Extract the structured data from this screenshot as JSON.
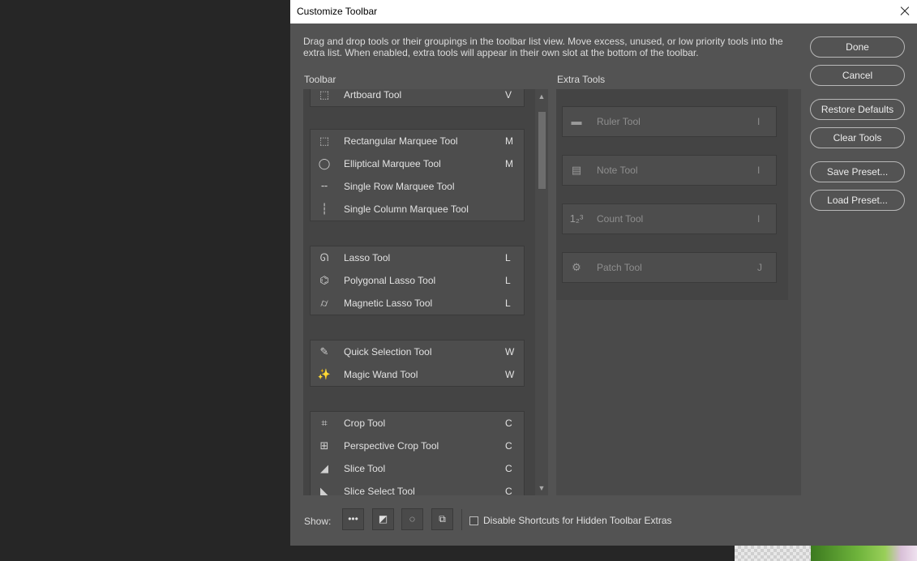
{
  "dialog": {
    "title": "Customize Toolbar",
    "description": "Drag and drop tools or their groupings in the toolbar list view. Move excess, unused, or low priority tools into the extra list. When enabled, extra tools will appear in their own slot at the bottom of the toolbar."
  },
  "toolbar": {
    "label": "Toolbar",
    "groups": [
      {
        "tools": [
          {
            "icon": "artboard-icon",
            "glyph": "⬚",
            "name": "Artboard Tool",
            "key": "V"
          }
        ]
      },
      {
        "tools": [
          {
            "icon": "rectangular-marquee-icon",
            "glyph": "⬚",
            "name": "Rectangular Marquee Tool",
            "key": "M"
          },
          {
            "icon": "elliptical-marquee-icon",
            "glyph": "◯",
            "name": "Elliptical Marquee Tool",
            "key": "M"
          },
          {
            "icon": "single-row-marquee-icon",
            "glyph": "╌",
            "name": "Single Row Marquee Tool",
            "key": ""
          },
          {
            "icon": "single-column-marquee-icon",
            "glyph": "┆",
            "name": "Single Column Marquee Tool",
            "key": ""
          }
        ]
      },
      {
        "tools": [
          {
            "icon": "lasso-icon",
            "glyph": "ᘏ",
            "name": "Lasso Tool",
            "key": "L"
          },
          {
            "icon": "polygonal-lasso-icon",
            "glyph": "⌬",
            "name": "Polygonal Lasso Tool",
            "key": "L"
          },
          {
            "icon": "magnetic-lasso-icon",
            "glyph": "⌭",
            "name": "Magnetic Lasso Tool",
            "key": "L"
          }
        ]
      },
      {
        "tools": [
          {
            "icon": "quick-selection-icon",
            "glyph": "✎",
            "name": "Quick Selection Tool",
            "key": "W"
          },
          {
            "icon": "magic-wand-icon",
            "glyph": "✨",
            "name": "Magic Wand Tool",
            "key": "W"
          }
        ]
      },
      {
        "tools": [
          {
            "icon": "crop-icon",
            "glyph": "⌗",
            "name": "Crop Tool",
            "key": "C"
          },
          {
            "icon": "perspective-crop-icon",
            "glyph": "⊞",
            "name": "Perspective Crop Tool",
            "key": "C"
          },
          {
            "icon": "slice-icon",
            "glyph": "◢",
            "name": "Slice Tool",
            "key": "C"
          },
          {
            "icon": "slice-select-icon",
            "glyph": "◣",
            "name": "Slice Select Tool",
            "key": "C"
          }
        ]
      }
    ]
  },
  "extra_tools": {
    "label": "Extra Tools",
    "items": [
      {
        "icon": "ruler-icon",
        "glyph": "▬",
        "name": "Ruler Tool",
        "key": "I"
      },
      {
        "icon": "note-icon",
        "glyph": "▤",
        "name": "Note Tool",
        "key": "I"
      },
      {
        "icon": "count-icon",
        "glyph": "1₂³",
        "name": "Count Tool",
        "key": "I"
      },
      {
        "icon": "patch-icon",
        "glyph": "⚙",
        "name": "Patch Tool",
        "key": "J"
      }
    ]
  },
  "buttons": {
    "done": "Done",
    "cancel": "Cancel",
    "restore_defaults": "Restore Defaults",
    "clear_tools": "Clear Tools",
    "save_preset": "Save Preset...",
    "load_preset": "Load Preset..."
  },
  "footer": {
    "show_label": "Show:",
    "show_buttons": [
      {
        "icon": "more-ellipsis-icon",
        "glyph": "•••"
      },
      {
        "icon": "foreground-background-icon",
        "glyph": "◩"
      },
      {
        "icon": "quick-mask-icon",
        "glyph": "◌"
      },
      {
        "icon": "screen-mode-icon",
        "glyph": "⧉"
      }
    ],
    "checkbox_label": "Disable Shortcuts for Hidden Toolbar Extras",
    "checkbox_checked": false
  }
}
